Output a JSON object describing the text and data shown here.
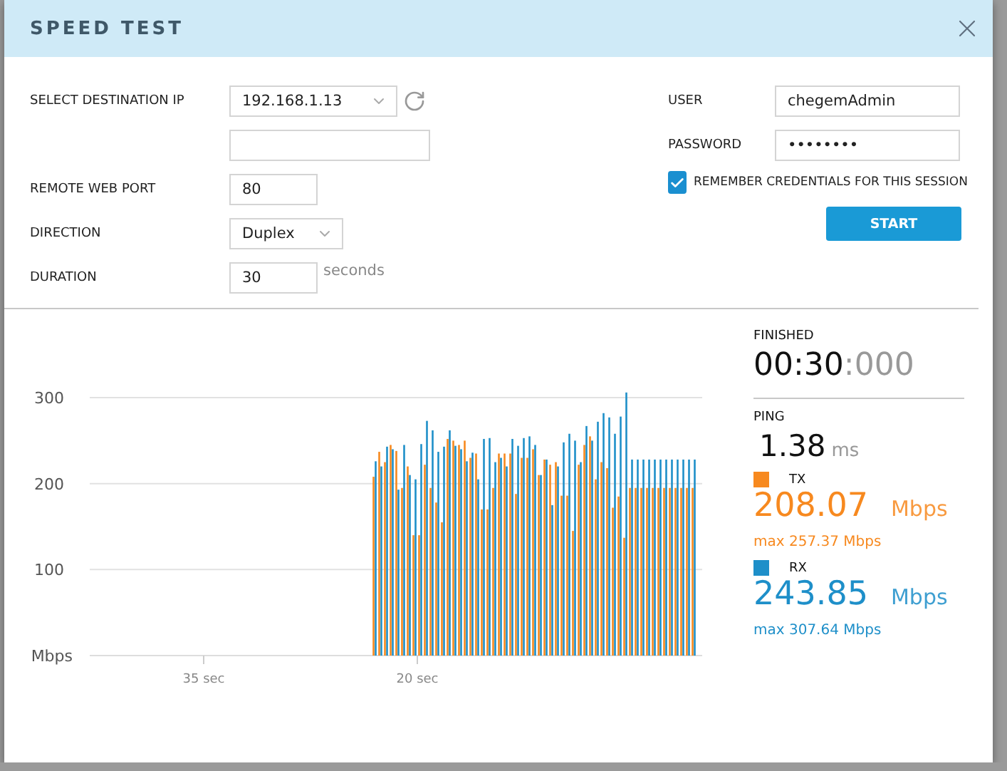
{
  "window": {
    "title": "SPEED TEST"
  },
  "form": {
    "fields": [
      {
        "kind": "select",
        "label": "SELECT DESTINATION IP",
        "value": "192.168.1.13"
      },
      {
        "kind": "blank"
      },
      {
        "kind": "text",
        "label": "REMOTE WEB PORT",
        "value": "80"
      },
      {
        "kind": "select",
        "label": "DIRECTION",
        "value": "Duplex"
      },
      {
        "kind": "text",
        "label": "DURATION",
        "value": "30",
        "unit": "seconds"
      }
    ],
    "credentials": [
      {
        "label": "USER",
        "value": "chegemAdmin"
      },
      {
        "label": "PASSWORD",
        "value": "••••••••"
      }
    ],
    "remember": {
      "label": "REMEMBER CREDENTIALS FOR THIS SESSION",
      "checked": true
    },
    "start_button": "START"
  },
  "chart_data": {
    "type": "bar",
    "ylabel": "Mbps",
    "xlim": [
      43,
      0
    ],
    "ylim": [
      0,
      310
    ],
    "grid": true,
    "yticks": [
      100,
      200,
      300
    ],
    "xticks": [
      {
        "value": 35,
        "label": "35 sec"
      },
      {
        "value": 20,
        "label": "20 sec"
      }
    ],
    "x": [
      23,
      22.6,
      22.2,
      21.8,
      21.4,
      21,
      20.6,
      20.2,
      19.8,
      19.4,
      19,
      18.6,
      18.2,
      17.8,
      17.4,
      17,
      16.6,
      16.2,
      15.8,
      15.4,
      15,
      14.6,
      14.2,
      13.8,
      13.4,
      13,
      12.6,
      12.2,
      11.8,
      11.4,
      11,
      10.6,
      10.2,
      9.8,
      9.4,
      9,
      8.6,
      8.2,
      7.8,
      7.4,
      7,
      6.6,
      6.2,
      5.8,
      5.4,
      5,
      4.6,
      4.2,
      3.8,
      3.4,
      3,
      2.6,
      2.2,
      1.8,
      1.4,
      1,
      0.6
    ],
    "series": [
      {
        "name": "TX",
        "color": "#f7891f",
        "values": [
          208,
          237,
          225,
          245,
          238,
          195,
          220,
          140,
          140,
          222,
          195,
          178,
          155,
          252,
          250,
          245,
          250,
          230,
          235,
          170,
          170,
          195,
          235,
          235,
          235,
          188,
          230,
          230,
          240,
          210,
          228,
          222,
          225,
          186,
          186,
          145,
          222,
          245,
          255,
          205,
          225,
          218,
          172,
          185,
          137,
          195,
          195,
          195,
          195,
          195,
          195,
          195,
          195,
          195,
          195,
          195,
          195
        ]
      },
      {
        "name": "RX",
        "color": "#1e8fc9",
        "values": [
          226,
          220,
          243,
          240,
          193,
          245,
          210,
          205,
          246,
          273,
          262,
          237,
          243,
          262,
          244,
          240,
          226,
          236,
          205,
          252,
          253,
          225,
          230,
          220,
          252,
          244,
          253,
          255,
          245,
          210,
          228,
          175,
          220,
          248,
          258,
          250,
          225,
          267,
          250,
          272,
          282,
          277,
          258,
          278,
          306,
          228,
          228,
          228,
          228,
          228,
          228,
          228,
          228,
          228,
          228,
          228,
          228
        ]
      }
    ]
  },
  "stats": {
    "finished": {
      "label": "FINISHED",
      "time": "00:30",
      "fraction": ":000"
    },
    "ping": {
      "label": "PING",
      "value": "1.38",
      "unit": "ms"
    },
    "rates": [
      {
        "value": "208.07",
        "unit": "Mbps",
        "max": "max 257.37 Mbps"
      },
      {
        "value": "243.85",
        "unit": "Mbps",
        "max": "max 307.64 Mbps"
      }
    ]
  }
}
